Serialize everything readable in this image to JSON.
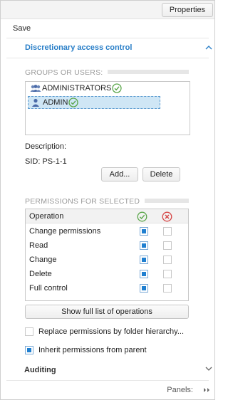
{
  "toolbar": {
    "properties_label": "Properties",
    "save_label": "Save"
  },
  "access_section": {
    "title": "Discretionary access control",
    "expanded": true
  },
  "groups": {
    "header": "GROUPS OR USERS:",
    "items": [
      {
        "label": "ADMINISTRATORS",
        "icon": "group-icon",
        "status_icon": "check-circle-icon",
        "selected": false
      },
      {
        "label": "ADMIN",
        "icon": "user-icon",
        "status_icon": "check-circle-icon",
        "selected": true
      }
    ]
  },
  "details": {
    "description_label": "Description:",
    "sid_label": "SID:",
    "sid_value": "PS-1-1"
  },
  "buttons": {
    "add": "Add...",
    "delete": "Delete",
    "show_all": "Show full list of operations"
  },
  "permissions": {
    "header": "PERMISSIONS FOR SELECTED",
    "column_operation": "Operation",
    "allow_icon": "check-circle-icon",
    "deny_icon": "x-circle-icon",
    "rows": [
      {
        "name": "Change permissions",
        "allow": true,
        "deny": false
      },
      {
        "name": "Read",
        "allow": true,
        "deny": false
      },
      {
        "name": "Change",
        "allow": true,
        "deny": false
      },
      {
        "name": "Delete",
        "allow": true,
        "deny": false
      },
      {
        "name": "Full control",
        "allow": true,
        "deny": false
      }
    ]
  },
  "options": {
    "replace_label": "Replace permissions by folder hierarchy...",
    "replace_checked": false,
    "inherit_label": "Inherit permissions from parent",
    "inherit_checked": true
  },
  "auditing": {
    "title": "Auditing",
    "expanded": false
  },
  "footer": {
    "panels_label": "Panels:"
  },
  "colors": {
    "accent": "#2a7fc8",
    "selection": "#cfe6f5",
    "checkbox_fill": "#1f7fd0",
    "allow": "#5aa64a",
    "deny": "#d64545"
  }
}
